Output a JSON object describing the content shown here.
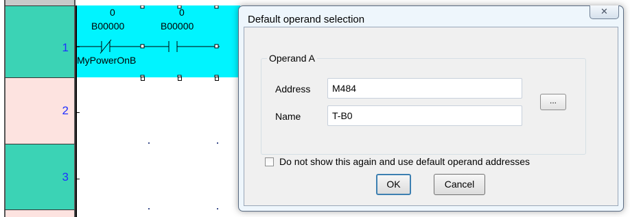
{
  "ladder": {
    "rung_numbers": [
      "1",
      "2",
      "3"
    ],
    "contacts": [
      {
        "value": "0",
        "address": "B00000",
        "type": "normally-closed"
      },
      {
        "value": "0",
        "address": "B00000",
        "type": "normally-open"
      }
    ],
    "symbol_name": "MyPowerOnB"
  },
  "dialog": {
    "title": "Default operand selection",
    "close_glyph": "✕",
    "group_label": "Operand A",
    "address_label": "Address",
    "address_value": "M484",
    "name_label": "Name",
    "name_value": "T-B0",
    "browse_label": "...",
    "checkbox_label": "Do not show this again and use default operand addresses",
    "checkbox_checked": false,
    "ok_label": "OK",
    "cancel_label": "Cancel"
  },
  "colors": {
    "rung_teal": "#3bd3b5",
    "rung_pink": "#fde3e0",
    "selected_rung": "#00f4ff",
    "rung_number": "#1f2fff",
    "dialog_frame": "#eef6fc"
  }
}
